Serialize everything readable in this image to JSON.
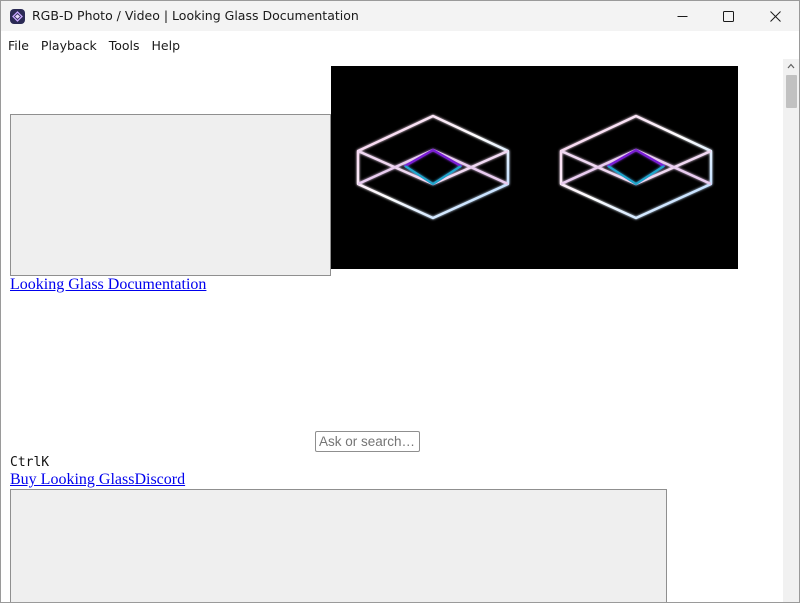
{
  "window": {
    "title": "RGB-D Photo / Video | Looking Glass Documentation",
    "app_icon": "looking-glass-app-icon",
    "controls": [
      "minimize-icon",
      "maximize-icon",
      "close-icon"
    ]
  },
  "menu": {
    "items": [
      "File",
      "Playback",
      "Tools",
      "Help"
    ]
  },
  "page": {
    "doc_link": "Looking Glass Documentation",
    "search_placeholder": "Ask or search…",
    "shortcut": "CtrlK",
    "buy_link": "Buy Looking Glass",
    "discord_link": "Discord",
    "hero_image": "stereo-wireframe-cubes"
  },
  "colors": {
    "link": "#0000ee",
    "hero_bg": "#000000",
    "placeholder_bg": "#efefef"
  }
}
